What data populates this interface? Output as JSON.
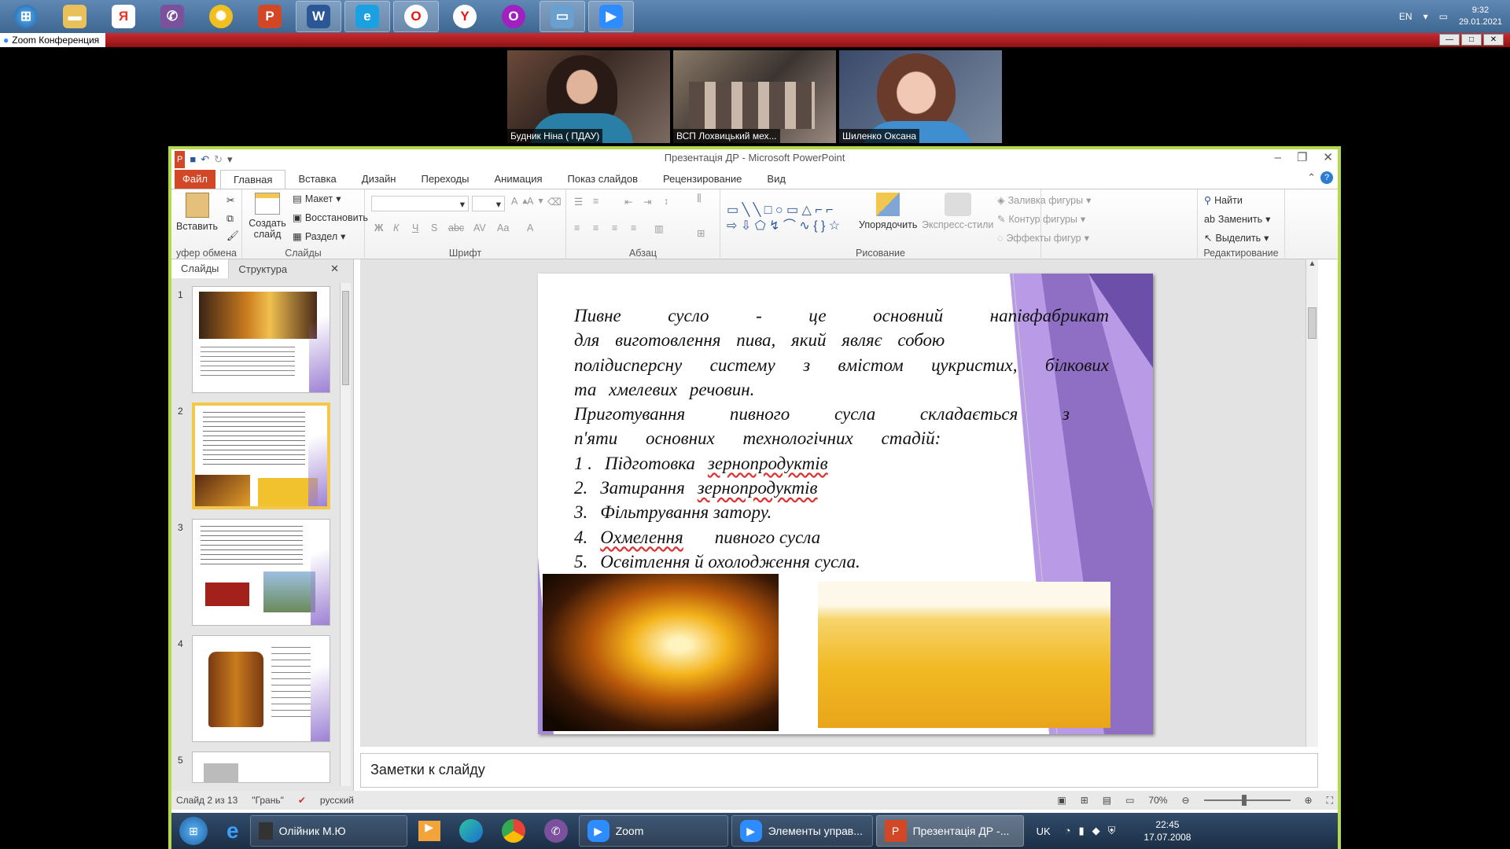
{
  "host_taskbar": {
    "apps": [
      "windows-start",
      "explorer",
      "yandex-browser",
      "viber",
      "file-manager",
      "powerpoint",
      "word",
      "internet-explorer",
      "opera",
      "yandex",
      "opera-gx",
      "remote-desktop",
      "zoom"
    ],
    "lang": "EN",
    "time": "9:32",
    "date": "29.01.2021"
  },
  "zoom": {
    "title": "Zoom Конференция",
    "participants": [
      "Будник Ніна ( ПДАУ)",
      "ВСП Лохвицький мех...",
      "Шиленко Оксана"
    ]
  },
  "ppt": {
    "title": "Презентація ДР - Microsoft PowerPoint",
    "tabs": [
      "Файл",
      "Главная",
      "Вставка",
      "Дизайн",
      "Переходы",
      "Анимация",
      "Показ слайдов",
      "Рецензирование",
      "Вид"
    ],
    "ribbon": {
      "paste": "Вставить",
      "clipboard": "уфер обмена",
      "new_slide": "Создать слайд",
      "layout": "Макет",
      "reset": "Восстановить",
      "section": "Раздел",
      "slides": "Слайды",
      "font": "Шрифт",
      "paragraph": "Абзац",
      "arrange": "Упорядочить",
      "quick_styles": "Экспресс-стили",
      "shape_fill": "Заливка фигуры",
      "shape_outline": "Контур фигуры",
      "shape_effects": "Эффекты фигур",
      "drawing": "Рисование",
      "find": "Найти",
      "replace": "Заменить",
      "select": "Выделить",
      "editing": "Редактирование"
    },
    "side_tabs": [
      "Слайды",
      "Структура"
    ],
    "thumbs": [
      "1",
      "2",
      "3",
      "4",
      "5"
    ],
    "slide": {
      "lines": [
        "Пивне сусло - це основний напівфабрикат",
        "для виготовлення пива, який являє собою",
        "полідисперсну систему з вмістом цукристих, білкових",
        "та хмелевих речовин.",
        "Приготування пивного сусла складається з",
        "п'яти основних технологічних стадій:"
      ],
      "items": [
        {
          "n": "1 .",
          "text": "Підготовка",
          "u": "зернопродуктів"
        },
        {
          "n": "2.",
          "text": "Затирання",
          "u": "зернопродуктів"
        },
        {
          "n": "3.",
          "text": "Фільтрування затору.",
          "u": ""
        },
        {
          "n": "4.",
          "text": "",
          "u": "Охмелення",
          "tail": "пивного сусла"
        },
        {
          "n": "5.",
          "text": "Освітлення й охолодження сусла.",
          "u": ""
        }
      ]
    },
    "notes": "Заметки к слайду",
    "status": {
      "slide": "Слайд 2 из 13",
      "theme": "\"Грань\"",
      "lang": "русский",
      "zoom": "70%"
    }
  },
  "inner_taskbar": {
    "items": [
      "Олійник М.Ю",
      "Zoom",
      "Элементы управ...",
      "Презентація ДР -..."
    ],
    "lang": "UK",
    "time": "22:45",
    "date": "17.07.2008"
  },
  "colors": {
    "accent": "#b4d94a",
    "file_tab": "#d24726",
    "zoom_bar": "#c92c30",
    "slide_purple": "#8e6fc4"
  }
}
